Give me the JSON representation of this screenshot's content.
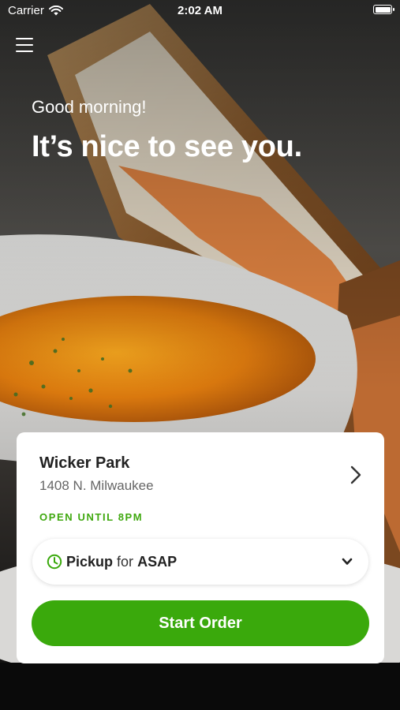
{
  "status_bar": {
    "carrier": "Carrier",
    "time": "2:02 AM"
  },
  "hero": {
    "greeting": "Good morning!",
    "headline": "It’s nice to see you."
  },
  "store": {
    "name": "Wicker Park",
    "address": "1408 N. Milwaukee",
    "hours": "OPEN UNTIL 8PM"
  },
  "order_options": {
    "method": "Pickup",
    "connector": "for",
    "time": "ASAP"
  },
  "cta": {
    "start_order": "Start Order"
  },
  "icons": {
    "menu": "hamburger-icon",
    "store_chevron": "chevron-right-icon",
    "clock": "clock-icon",
    "dropdown": "chevron-down-icon",
    "wifi": "wifi-icon",
    "battery": "battery-icon"
  },
  "colors": {
    "accent_green": "#3aa90c",
    "hours_green": "#3fa80f",
    "card_bg": "#ffffff"
  }
}
